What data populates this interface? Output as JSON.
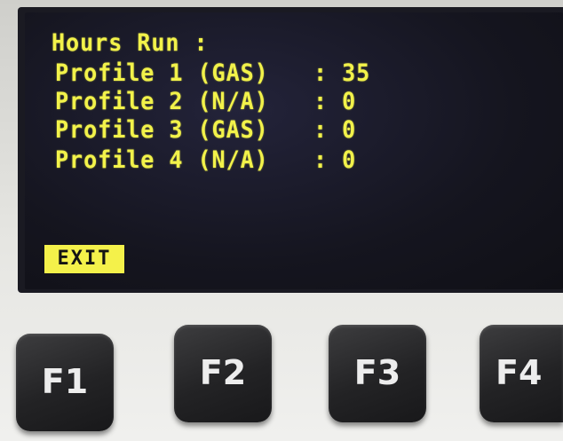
{
  "screen": {
    "title": "Hours Run :",
    "rows": [
      {
        "label": "Profile 1 (GAS)",
        "value": ": 35"
      },
      {
        "label": "Profile 2 (N/A)",
        "value": ": 0"
      },
      {
        "label": "Profile 3 (GAS)",
        "value": ": 0"
      },
      {
        "label": "Profile 4 (N/A)",
        "value": ": 0"
      }
    ],
    "exit_label": "EXIT"
  },
  "keys": [
    {
      "label": "F1"
    },
    {
      "label": "F2"
    },
    {
      "label": "F3"
    },
    {
      "label": "F4"
    }
  ],
  "colors": {
    "lcd_text": "#f2f24a",
    "screen_bg": "#15151f",
    "key_bg": "#232325"
  }
}
